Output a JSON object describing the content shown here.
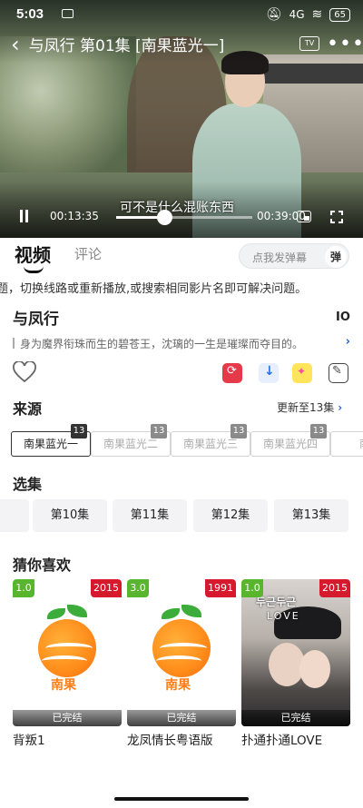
{
  "status_bar": {
    "time": "5:03",
    "network": "4G",
    "battery": "65"
  },
  "player": {
    "title": "与凤行 第01集 [南果蓝光一]",
    "subtitle": "可不是什么混账东西",
    "current_time": "00:13:35",
    "total_time": "00:39:00",
    "progress_fraction": 0.35,
    "tv_label": "TV"
  },
  "tabs": {
    "video": "视频",
    "comment": "评论",
    "danmu_placeholder": "点我发弹幕",
    "danmu_button": "弹"
  },
  "notice": "题，切换线路或重新播放,或搜索相同影片名即可解决问题。",
  "show": {
    "title": "与凤行",
    "code": "IO",
    "description": "身为魔界衔珠而生的碧苍王，沈璃的一生是璀璨而夺目的。"
  },
  "source_section": {
    "title": "来源",
    "more": "更新至13集",
    "sources": [
      {
        "label": "南果蓝光一",
        "count": "13"
      },
      {
        "label": "南果蓝光二",
        "count": "13"
      },
      {
        "label": "南果蓝光三",
        "count": "13"
      },
      {
        "label": "南果蓝光四",
        "count": "13"
      },
      {
        "label": "南果",
        "count": "13"
      }
    ]
  },
  "episode_section": {
    "title": "选集",
    "episodes": [
      "集",
      "第10集",
      "第11集",
      "第12集",
      "第13集"
    ]
  },
  "recommend_section": {
    "title": "猜你喜欢",
    "items": [
      {
        "rating": "1.0",
        "year": "2015",
        "status": "已完结",
        "name": "背叛1",
        "logo_text": "南果"
      },
      {
        "rating": "3.0",
        "year": "1991",
        "status": "已完结",
        "name": "龙凤情长粤语版",
        "logo_text": "南果"
      },
      {
        "rating": "1.0",
        "year": "2015",
        "status": "已完结",
        "name": "扑通扑通LOVE",
        "poster_kr": "두근두근",
        "poster_love": "LOVE"
      }
    ]
  }
}
